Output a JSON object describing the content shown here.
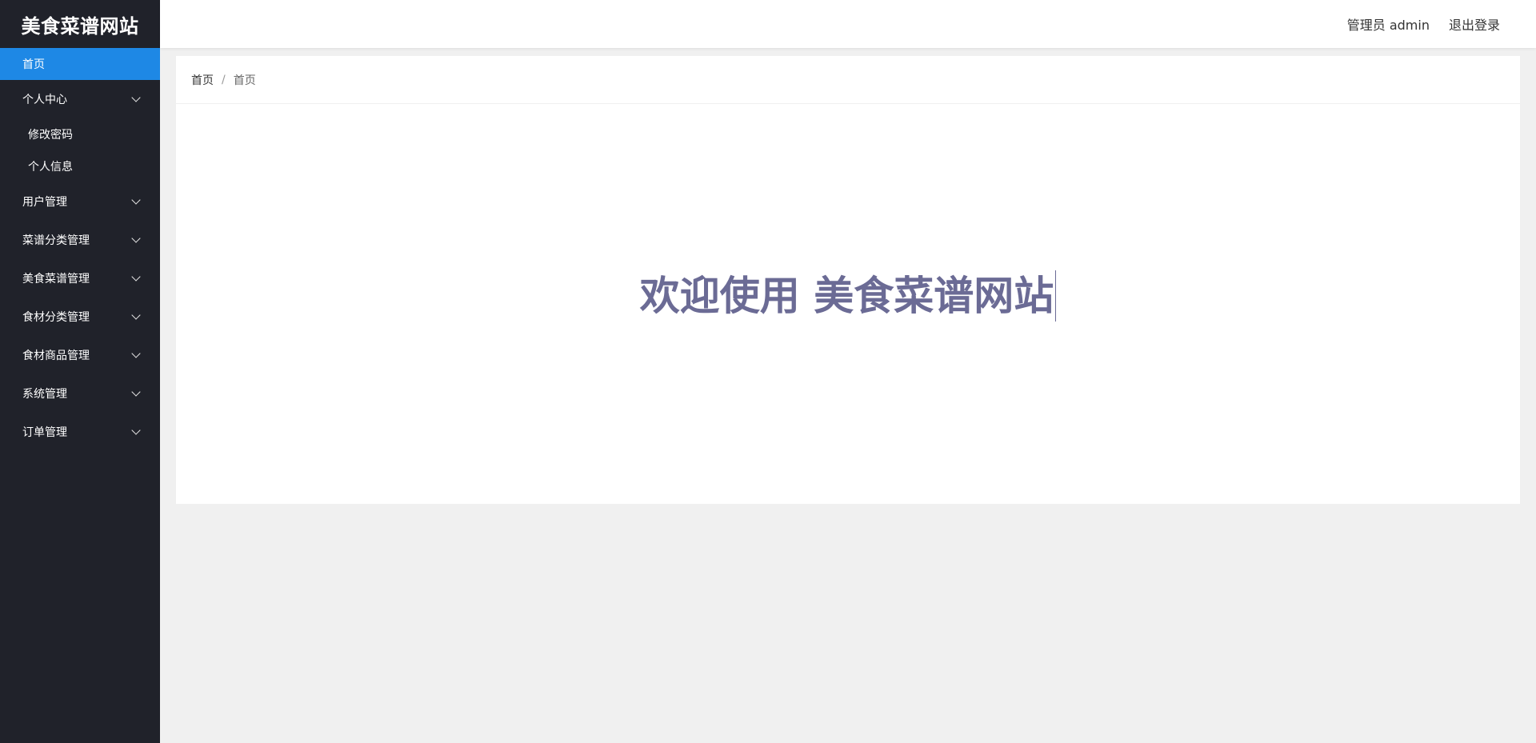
{
  "sidebar": {
    "logo": "美食菜谱网站",
    "home": "首页",
    "groups": [
      {
        "label": "个人中心",
        "children": [
          "修改密码",
          "个人信息"
        ]
      },
      {
        "label": "用户管理"
      },
      {
        "label": "菜谱分类管理"
      },
      {
        "label": "美食菜谱管理"
      },
      {
        "label": "食材分类管理"
      },
      {
        "label": "食材商品管理"
      },
      {
        "label": "系统管理"
      },
      {
        "label": "订单管理"
      }
    ]
  },
  "header": {
    "user": "管理员 admin",
    "logout": "退出登录"
  },
  "breadcrumb": {
    "root": "首页",
    "separator": "/",
    "current": "首页"
  },
  "main": {
    "welcome": "欢迎使用 美食菜谱网站"
  },
  "colors": {
    "sidebar_bg": "#20222a",
    "active": "#1e88e5",
    "welcome_text": "#6b6b95"
  }
}
